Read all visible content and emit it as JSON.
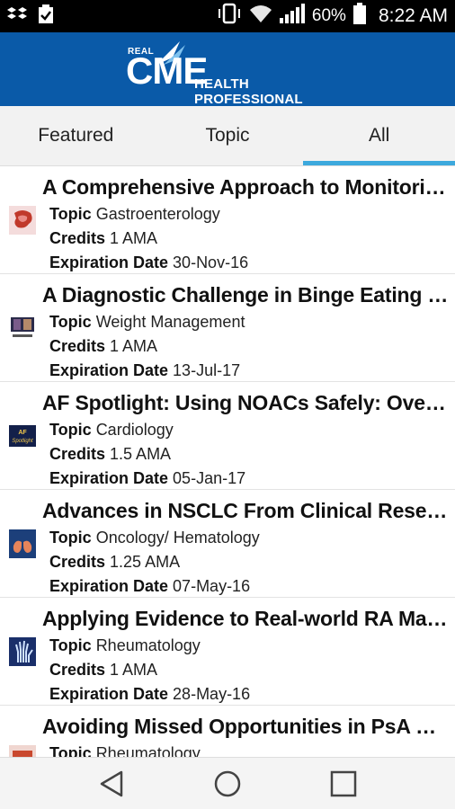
{
  "status_bar": {
    "battery": "60%",
    "time": "8:22 AM",
    "icons": [
      "dropbox-icon",
      "clipboard-check-icon",
      "vibrate-icon",
      "wifi-icon",
      "signal-icon",
      "battery-icon"
    ]
  },
  "header": {
    "logo_small": "REAL",
    "logo_main": "CME",
    "logo_sub": "HEALTH PROFESSIONAL",
    "brand_color": "#0a5aa8"
  },
  "tabs": [
    {
      "label": "Featured",
      "active": false
    },
    {
      "label": "Topic",
      "active": false
    },
    {
      "label": "All",
      "active": true
    }
  ],
  "labels": {
    "topic": "Topic",
    "credits": "Credits",
    "expiration": "Expiration Date"
  },
  "items": [
    {
      "title": "A Comprehensive Approach to Monitoring and Managing Inflammatory Bowel Disease",
      "topic": "Gastroenterology",
      "credits": "1 AMA",
      "expiration": "30-Nov-16",
      "icon": "gi-thumbnail-icon"
    },
    {
      "title": "A Diagnostic Challenge in Binge Eating Disorder",
      "topic": "Weight Management",
      "credits": "1 AMA",
      "expiration": "13-Jul-17",
      "icon": "weight-thumbnail-icon"
    },
    {
      "title": "AF Spotlight: Using NOACs Safely: Overview",
      "topic": "Cardiology",
      "credits": "1.5 AMA",
      "expiration": "05-Jan-17",
      "icon": "af-spotlight-thumbnail-icon"
    },
    {
      "title": "Advances in NSCLC From Clinical Research",
      "topic": "Oncology/ Hematology",
      "credits": "1.25 AMA",
      "expiration": "07-May-16",
      "icon": "lungs-thumbnail-icon"
    },
    {
      "title": "Applying Evidence to Real-world RA Management",
      "topic": "Rheumatology",
      "credits": "1 AMA",
      "expiration": "28-May-16",
      "icon": "hand-xray-thumbnail-icon"
    },
    {
      "title": "Avoiding Missed Opportunities in PsA Management",
      "topic": "Rheumatology",
      "credits": "",
      "expiration": "",
      "icon": "psa-thumbnail-icon"
    }
  ]
}
